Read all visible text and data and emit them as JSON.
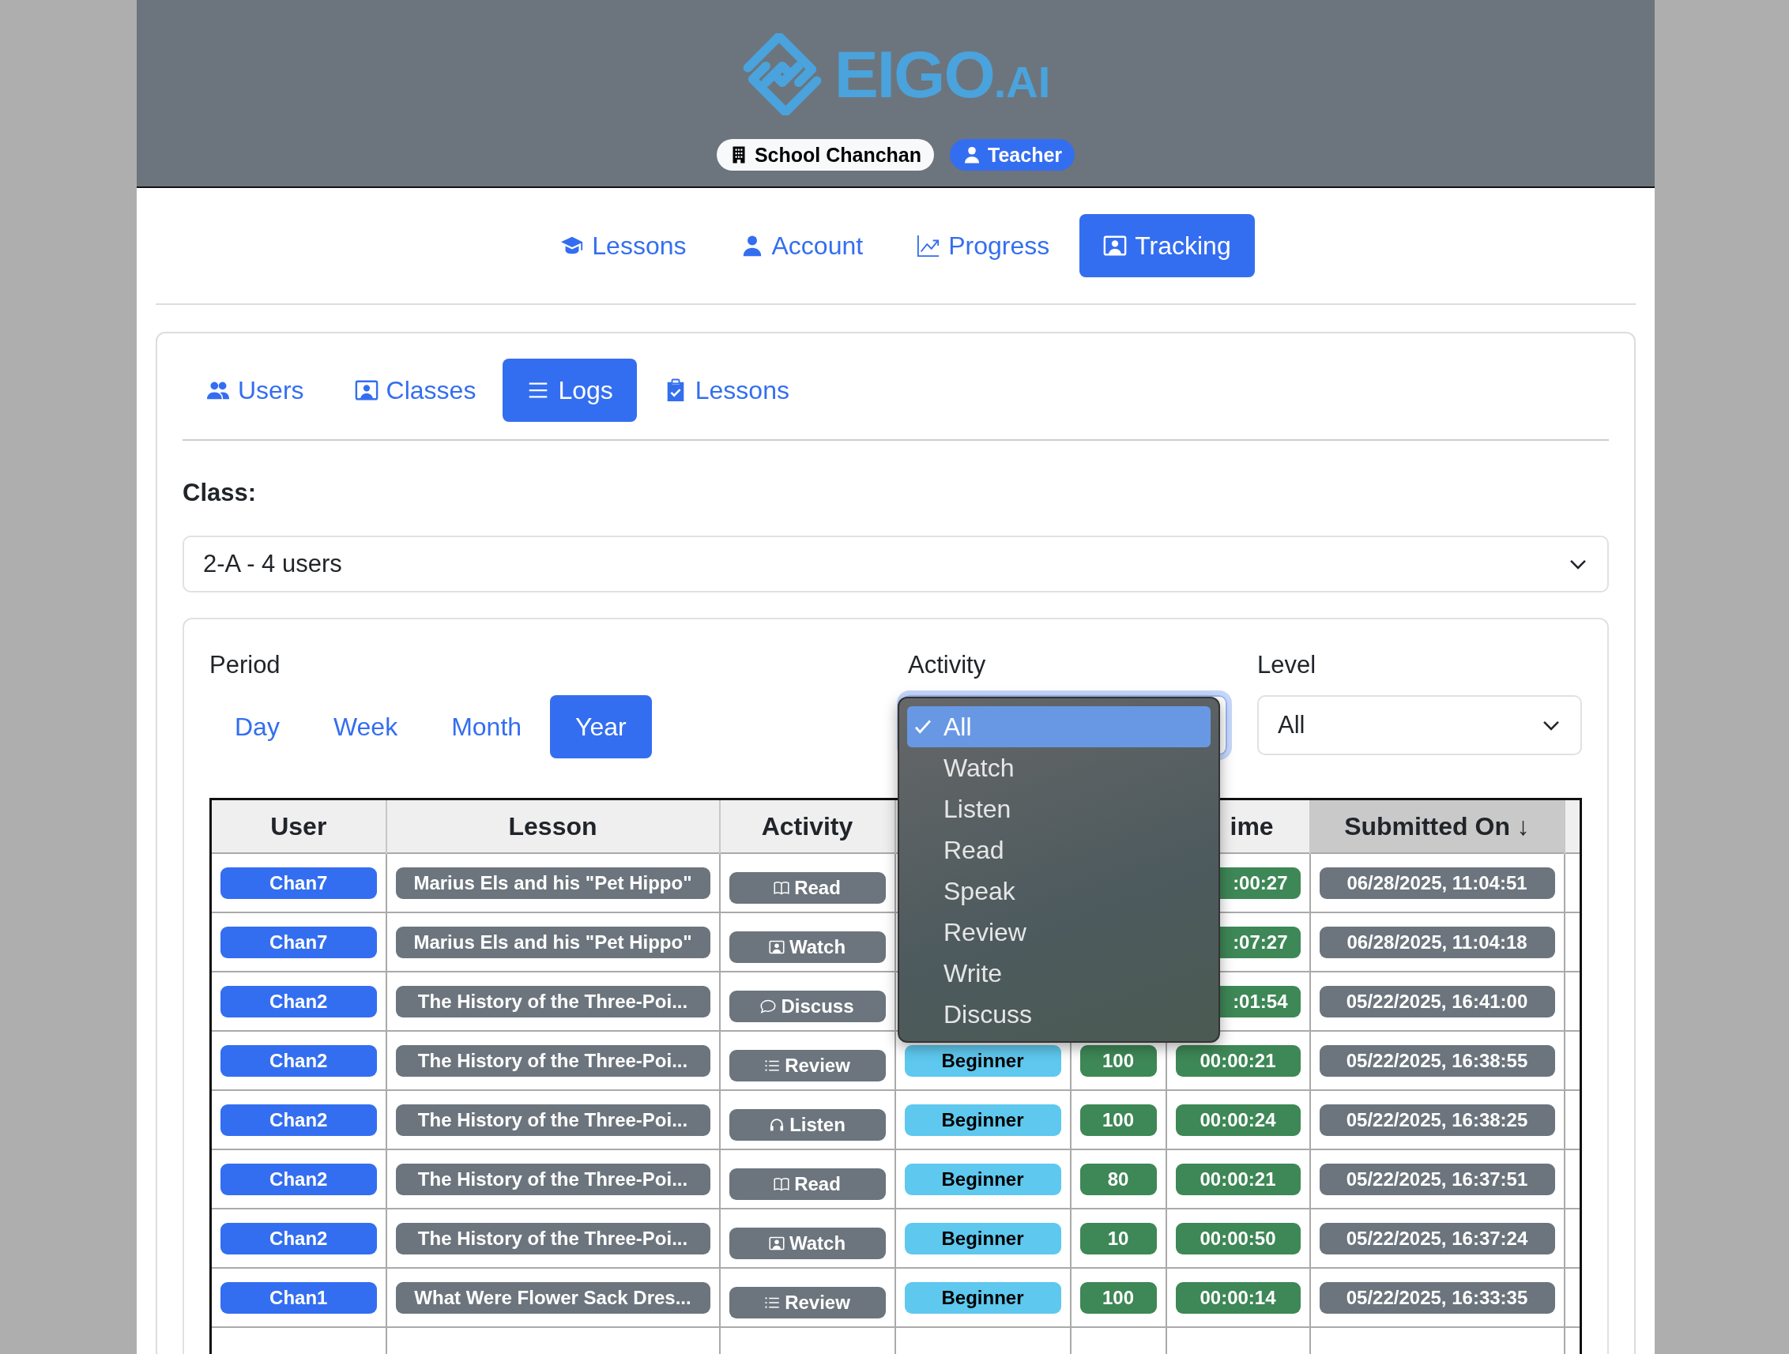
{
  "header": {
    "logo": {
      "text": "EIGO",
      "suffix": ".AI"
    },
    "badges": [
      {
        "kind": "school",
        "label": "School Chanchan"
      },
      {
        "kind": "role",
        "label": "Teacher"
      }
    ]
  },
  "nav": [
    {
      "label": "Lessons",
      "selected": false
    },
    {
      "label": "Account",
      "selected": false
    },
    {
      "label": "Progress",
      "selected": false
    },
    {
      "label": "Tracking",
      "selected": true
    }
  ],
  "subtabs": [
    {
      "label": "Users",
      "selected": false
    },
    {
      "label": "Classes",
      "selected": false
    },
    {
      "label": "Logs",
      "selected": true
    },
    {
      "label": "Lessons",
      "selected": false
    }
  ],
  "class_filter": {
    "label": "Class:",
    "value": "2-A - 4 users"
  },
  "filters": {
    "period": {
      "label": "Period",
      "options": [
        {
          "label": "Day",
          "selected": false
        },
        {
          "label": "Week",
          "selected": false
        },
        {
          "label": "Month",
          "selected": false
        },
        {
          "label": "Year",
          "selected": true
        }
      ]
    },
    "activity": {
      "label": "Activity",
      "menu": [
        {
          "label": "All",
          "selected": true
        },
        {
          "label": "Watch",
          "selected": false
        },
        {
          "label": "Listen",
          "selected": false
        },
        {
          "label": "Read",
          "selected": false
        },
        {
          "label": "Speak",
          "selected": false
        },
        {
          "label": "Review",
          "selected": false
        },
        {
          "label": "Write",
          "selected": false
        },
        {
          "label": "Discuss",
          "selected": false
        }
      ]
    },
    "level": {
      "label": "Level",
      "value": "All"
    }
  },
  "table": {
    "columns": [
      {
        "label": "User"
      },
      {
        "label": "Lesson"
      },
      {
        "label": "Activity"
      },
      {},
      {},
      {
        "label": "ime"
      },
      {
        "label": "Submitted On ↓",
        "sorted": true
      },
      {}
    ],
    "rows": [
      {
        "user": "Chan7",
        "lesson": "Marius Els and his \"Pet Hippo\"",
        "activity": {
          "kind": "read",
          "label": "Read"
        },
        "time": ":00:27",
        "submitted": "06/28/2025, 11:04:51"
      },
      {
        "user": "Chan7",
        "lesson": "Marius Els and his \"Pet Hippo\"",
        "activity": {
          "kind": "watch",
          "label": "Watch"
        },
        "time": ":07:27",
        "submitted": "06/28/2025, 11:04:18"
      },
      {
        "user": "Chan2",
        "lesson": "The History of the Three-Poi...",
        "activity": {
          "kind": "discuss",
          "label": "Discuss"
        },
        "time": ":01:54",
        "submitted": "05/22/2025, 16:41:00"
      },
      {
        "user": "Chan2",
        "lesson": "The History of the Three-Poi...",
        "activity": {
          "kind": "review",
          "label": "Review"
        },
        "level": "Beginner",
        "score": "100",
        "time": "00:00:21",
        "submitted": "05/22/2025, 16:38:55"
      },
      {
        "user": "Chan2",
        "lesson": "The History of the Three-Poi...",
        "activity": {
          "kind": "listen",
          "label": "Listen"
        },
        "level": "Beginner",
        "score": "100",
        "time": "00:00:24",
        "submitted": "05/22/2025, 16:38:25"
      },
      {
        "user": "Chan2",
        "lesson": "The History of the Three-Poi...",
        "activity": {
          "kind": "read",
          "label": "Read"
        },
        "level": "Beginner",
        "score": "80",
        "time": "00:00:21",
        "submitted": "05/22/2025, 16:37:51"
      },
      {
        "user": "Chan2",
        "lesson": "The History of the Three-Poi...",
        "activity": {
          "kind": "watch",
          "label": "Watch"
        },
        "level": "Beginner",
        "score": "10",
        "time": "00:00:50",
        "submitted": "05/22/2025, 16:37:24"
      },
      {
        "user": "Chan1",
        "lesson": "What Were Flower Sack Dres...",
        "activity": {
          "kind": "review",
          "label": "Review"
        },
        "level": "Beginner",
        "score": "100",
        "time": "00:00:14",
        "submitted": "05/22/2025, 16:33:35"
      }
    ]
  }
}
